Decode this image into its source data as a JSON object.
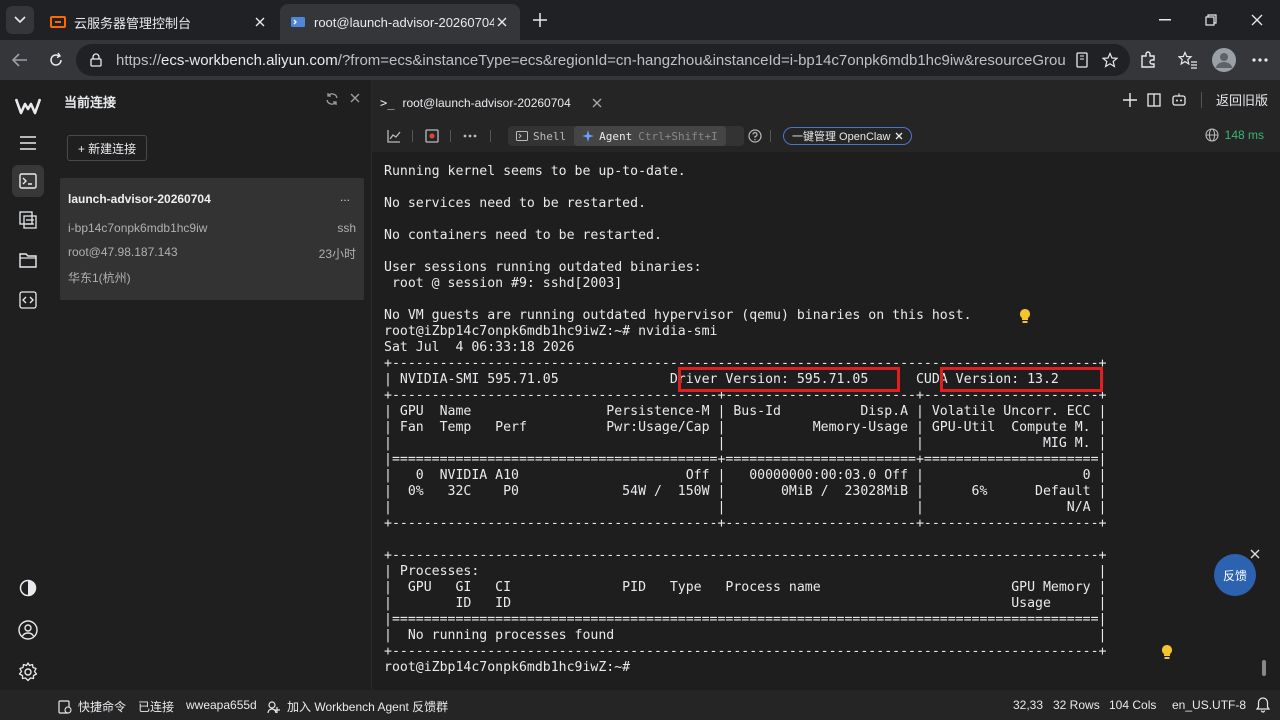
{
  "browser": {
    "tabs": [
      {
        "title": "云服务器管理控制台",
        "active": false
      },
      {
        "title": "root@launch-advisor-20260704 - ",
        "active": true
      }
    ],
    "url_prefix": "https://",
    "url_host": "ecs-workbench.aliyun.com",
    "url_rest": "/?from=ecs&instanceType=ecs&regionId=cn-hangzhou&instanceId=i-bp14c7onpk6mdb1hc9iw&resourceGroupId=&l..."
  },
  "panel": {
    "title": "当前连接",
    "new_connection": "+ 新建连接",
    "connection": {
      "name": "launch-advisor-20260704",
      "more": "...",
      "instance_id": "i-bp14c7onpk6mdb1hc9iw",
      "protocol": "ssh",
      "address": "root@47.98.187.143",
      "duration": "23小时",
      "region": "华东1(杭州)"
    }
  },
  "terminal_tab": {
    "prompt": ">_",
    "title": "root@launch-advisor-20260704"
  },
  "top_right": {
    "legacy": "返回旧版"
  },
  "toolbar": {
    "shell": "Shell",
    "agent": "Agent",
    "agent_shortcut": "Ctrl+Shift+I",
    "openclaw": "一键管理 OpenClaw",
    "latency": "148 ms"
  },
  "terminal": {
    "lines": [
      "Running kernel seems to be up-to-date.",
      "",
      "No services need to be restarted.",
      "",
      "No containers need to be restarted.",
      "",
      "User sessions running outdated binaries:",
      " root @ session #9: sshd[2003]",
      "",
      "No VM guests are running outdated hypervisor (qemu) binaries on this host.",
      "root@iZbp14c7onpk6mdb1hc9iwZ:~# nvidia-smi",
      "Sat Jul  4 06:33:18 2026",
      "+-----------------------------------------------------------------------------------------+",
      "| NVIDIA-SMI 595.71.05              Driver Version: 595.71.05      CUDA Version: 13.2     |",
      "+-----------------------------------------+------------------------+----------------------+",
      "| GPU  Name                 Persistence-M | Bus-Id          Disp.A | Volatile Uncorr. ECC |",
      "| Fan  Temp   Perf          Pwr:Usage/Cap |           Memory-Usage | GPU-Util  Compute M. |",
      "|                                         |                        |               MIG M. |",
      "|=========================================+========================+======================|",
      "|   0  NVIDIA A10                     Off |   00000000:00:03.0 Off |                    0 |",
      "|  0%   32C    P0             54W /  150W |       0MiB /  23028MiB |      6%      Default |",
      "|                                         |                        |                  N/A |",
      "+-----------------------------------------+------------------------+----------------------+",
      "",
      "+-----------------------------------------------------------------------------------------+",
      "| Processes:                                                                              |",
      "|  GPU   GI   CI              PID   Type   Process name                        GPU Memory |",
      "|        ID   ID                                                               Usage      |",
      "|=========================================================================================|",
      "|  No running processes found                                                             |",
      "+-----------------------------------------------------------------------------------------+",
      "root@iZbp14c7onpk6mdb1hc9iwZ:~# "
    ]
  },
  "feedback": "反馈",
  "statusbar": {
    "quick_cmd": "快捷命令",
    "connected": "已连接",
    "user": "wweapa655d",
    "join_group": "加入 Workbench Agent 反馈群",
    "cursor": "32,33",
    "rows": "32 Rows",
    "cols": "104 Cols",
    "encoding": "en_US.UTF-8"
  },
  "colors": {
    "accent_blue": "#2c62b0",
    "highlight_red": "#e02020",
    "latency_green": "#3bb56f",
    "aliyun_orange": "#ff6a00"
  }
}
